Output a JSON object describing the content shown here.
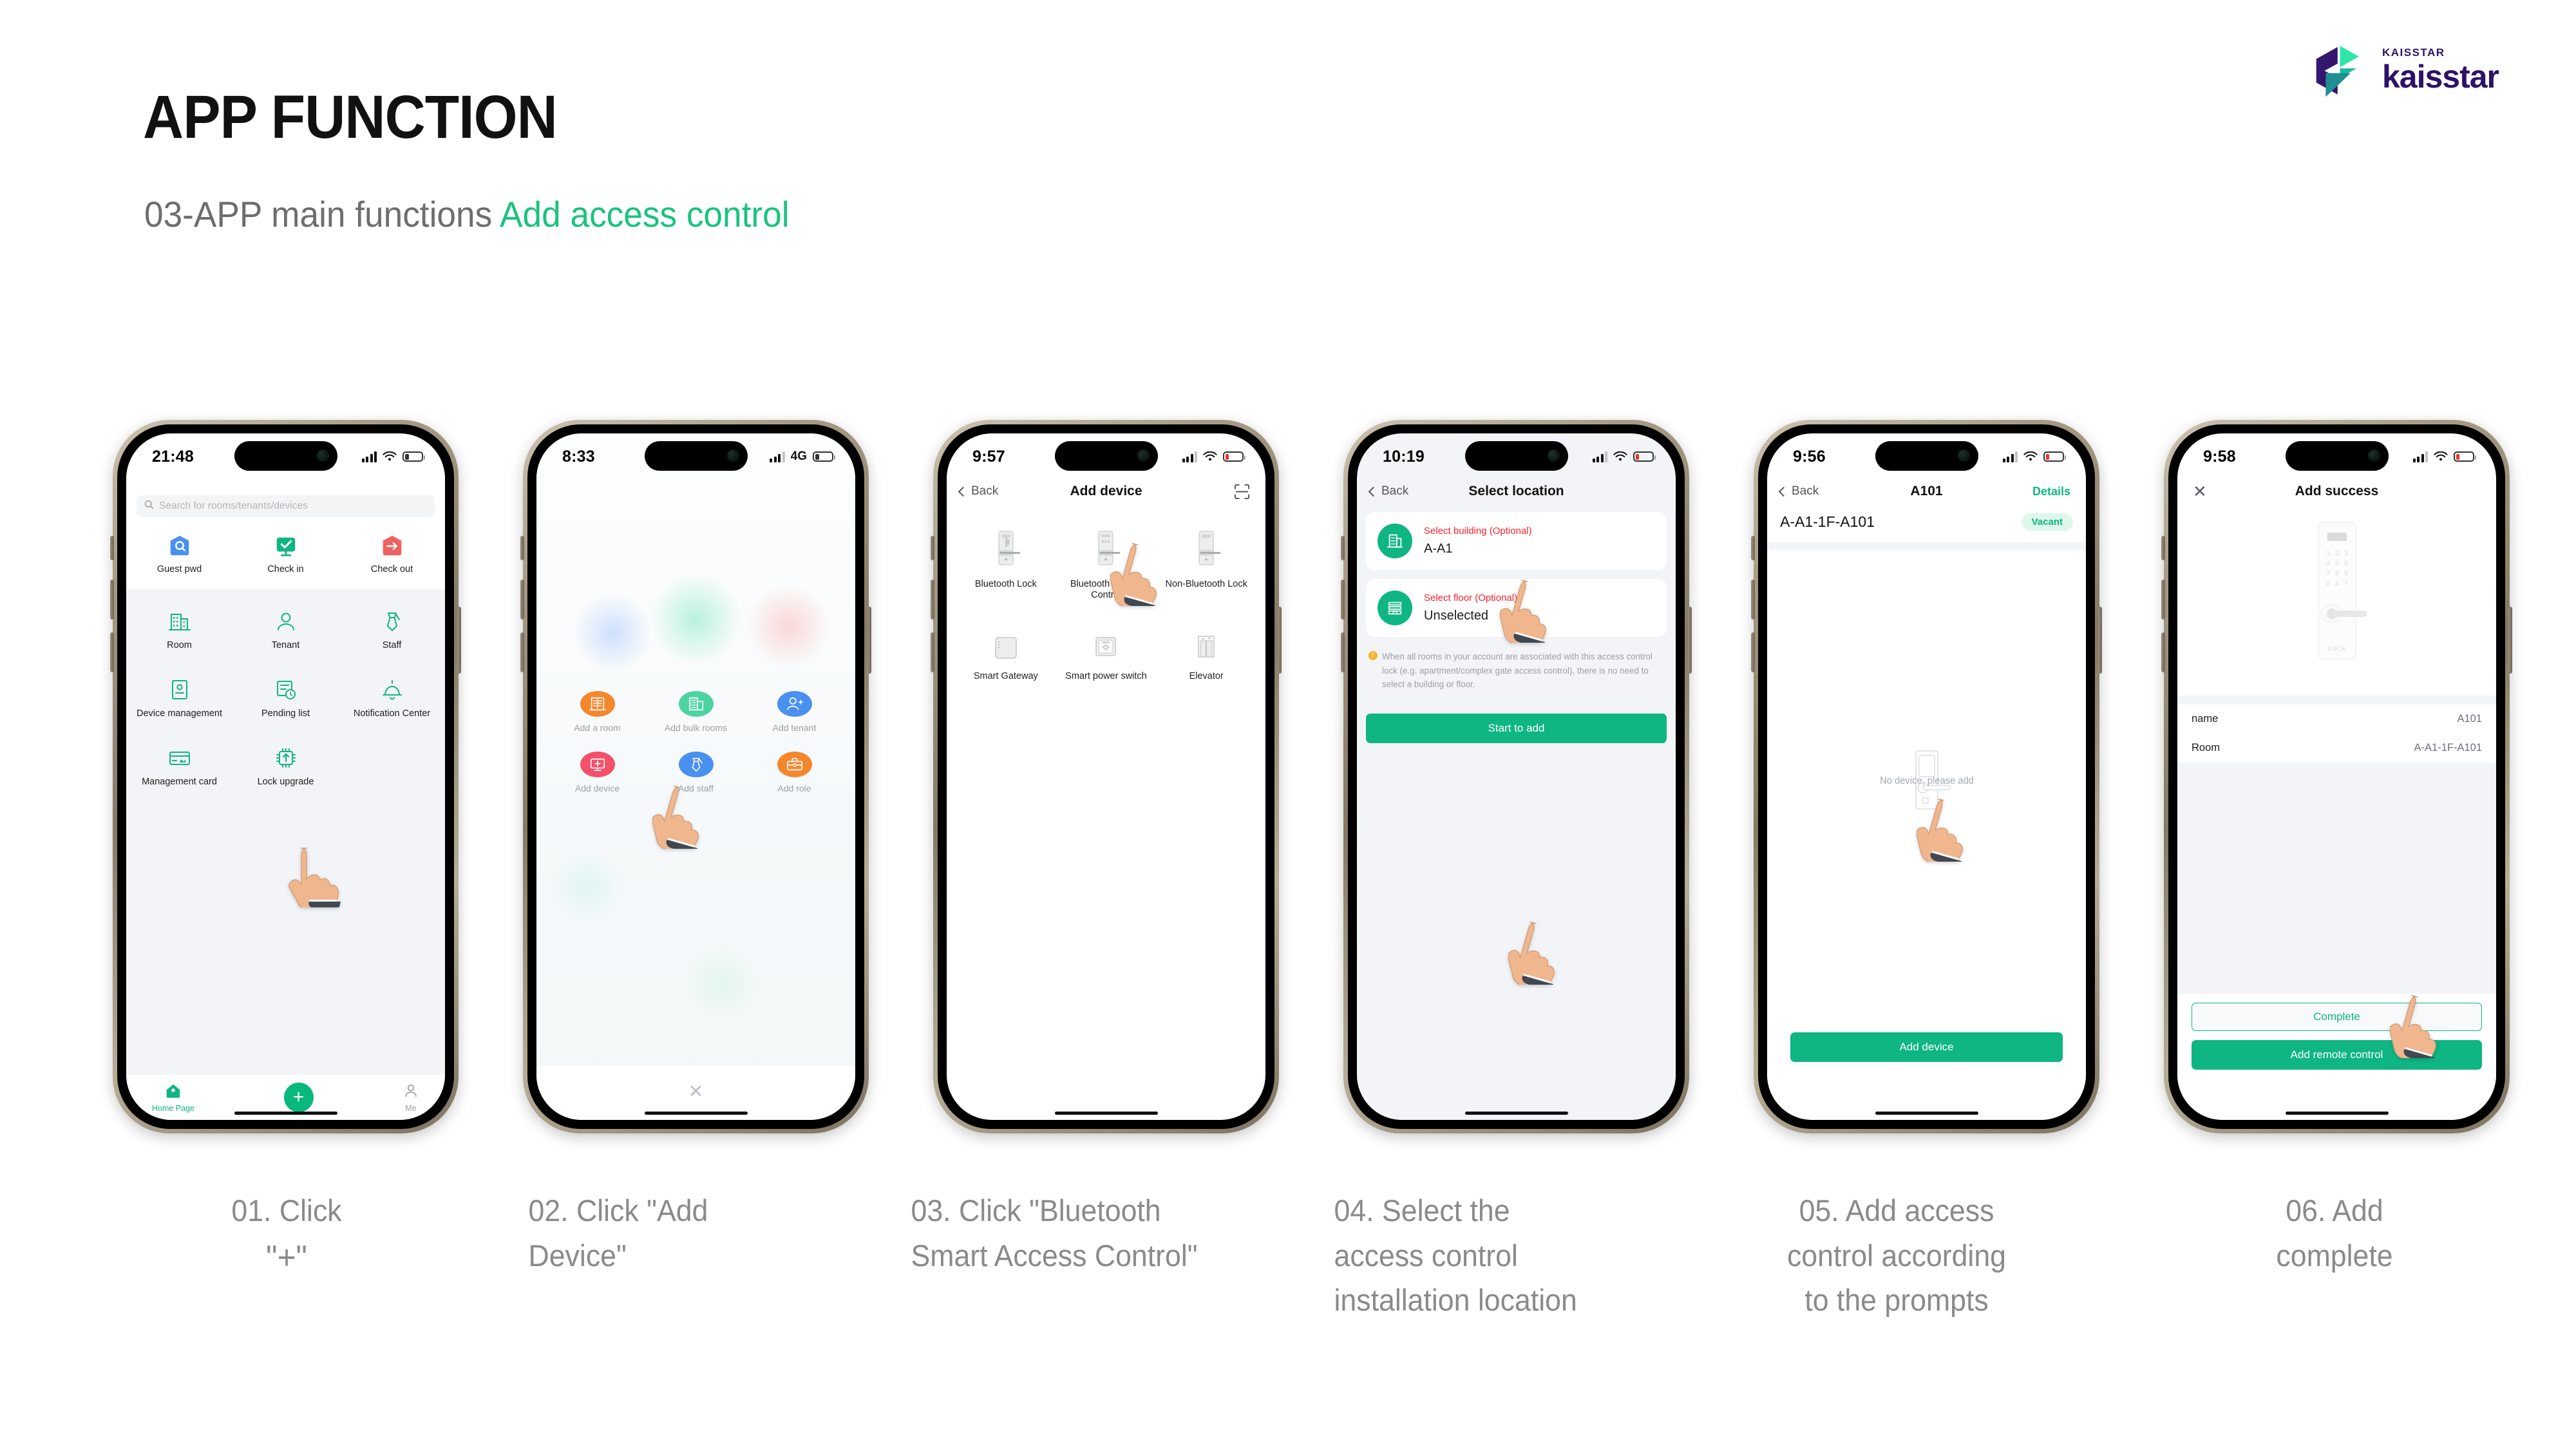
{
  "header": {
    "title": "APP FUNCTION",
    "subtitle_prefix": "03-APP main functions ",
    "subtitle_accent": "Add access control"
  },
  "brand": {
    "kicker": "KAISSTAR",
    "word": "kaisstar",
    "purple": "#2d1267",
    "teal": "#19c79b"
  },
  "theme": {
    "green": "#0fb583",
    "red": "#f5222d",
    "page_bg": "#ffffff",
    "screen_gray": "#f2f4f7"
  },
  "phones": [
    {
      "status": {
        "time": "21:48",
        "network": "",
        "battery_pct": 22,
        "battery_color": "#333333"
      },
      "search": {
        "placeholder": "Search for rooms/tenants/devices",
        "icon": "search-icon"
      },
      "quick_actions": [
        {
          "label": "Guest pwd",
          "icon": "shield-search-icon",
          "color": "#4a90f0"
        },
        {
          "label": "Check in",
          "icon": "monitor-check-icon",
          "color": "#0fb583"
        },
        {
          "label": "Check out",
          "icon": "shield-arrow-icon",
          "color": "#f16060"
        }
      ],
      "menu": [
        {
          "label": "Room",
          "icon": "building-icon"
        },
        {
          "label": "Tenant",
          "icon": "user-icon"
        },
        {
          "label": "Staff",
          "icon": "tie-icon"
        },
        {
          "label": "Device management",
          "icon": "device-card-icon"
        },
        {
          "label": "Pending list",
          "icon": "pending-clock-icon"
        },
        {
          "label": "Notification Center",
          "icon": "bell-icon"
        },
        {
          "label": "Management card",
          "icon": "card-icon"
        },
        {
          "label": "Lock upgrade",
          "icon": "chip-upgrade-icon"
        }
      ],
      "tabs": [
        {
          "label": "Home Page",
          "icon": "home-icon",
          "active": true
        },
        {
          "label": "",
          "icon": "plus-icon",
          "active": false
        },
        {
          "label": "Me",
          "icon": "person-icon",
          "active": false
        }
      ]
    },
    {
      "status": {
        "time": "8:33",
        "network": "4G",
        "battery_pct": 22,
        "battery_color": "#333333"
      },
      "actions": [
        {
          "label": "Add a room",
          "icon": "building-icon",
          "color": "#f4872c"
        },
        {
          "label": "Add bulk rooms",
          "icon": "buildings-icon",
          "color": "#4cd3a0"
        },
        {
          "label": "Add tenant",
          "icon": "user-plus-icon",
          "color": "#4a90f0"
        },
        {
          "label": "Add device",
          "icon": "monitor-plus-icon",
          "color": "#f4506a"
        },
        {
          "label": "Add staff",
          "icon": "tie-icon",
          "color": "#4a90f0"
        },
        {
          "label": "Add role",
          "icon": "briefcase-icon",
          "color": "#f4872c"
        }
      ],
      "close_icon": "close-icon"
    },
    {
      "status": {
        "time": "9:57",
        "network": "",
        "battery_pct": 16,
        "battery_color": "#f03030"
      },
      "nav": {
        "back": "Back",
        "title": "Add device",
        "right_icon": "scan-icon"
      },
      "devices": [
        {
          "label": "Bluetooth Lock",
          "icon": "bluetooth-lock-icon"
        },
        {
          "label": "Bluetooth Access Control",
          "icon": "access-control-icon"
        },
        {
          "label": "Non-Bluetooth Lock",
          "icon": "non-bluetooth-lock-icon"
        },
        {
          "label": "Smart Gateway",
          "icon": "gateway-icon"
        },
        {
          "label": "Smart power switch",
          "icon": "power-switch-icon"
        },
        {
          "label": "Elevator",
          "icon": "elevator-icon"
        }
      ]
    },
    {
      "status": {
        "time": "10:19",
        "network": "",
        "battery_pct": 16,
        "battery_color": "#f03030"
      },
      "nav": {
        "back": "Back",
        "title": "Select location"
      },
      "rows": [
        {
          "title": "Select building (Optional)",
          "value": "A-A1",
          "icon": "building-icon"
        },
        {
          "title": "Select floor (Optional)",
          "value": "Unselected",
          "icon": "floor-icon"
        }
      ],
      "note": "When all rooms in your account are associated with this access control lock (e.g. apartment/complex gate access control), there is no need to select a building or floor.",
      "note_icon": "warning-icon",
      "primary_button": "Start to add"
    },
    {
      "status": {
        "time": "9:56",
        "network": "",
        "battery_pct": 16,
        "battery_color": "#f03030"
      },
      "nav": {
        "back": "Back",
        "title": "A101",
        "right": "Details"
      },
      "room_path": "A-A1-1F-A101",
      "badge": "Vacant",
      "empty_text": "No device, please add",
      "empty_icon": "door-lock-icon",
      "primary_button": "Add device"
    },
    {
      "status": {
        "time": "9:58",
        "network": "",
        "battery_pct": 16,
        "battery_color": "#f03030"
      },
      "nav": {
        "close_icon": "close-icon",
        "title": "Add success"
      },
      "hero_icon": "smart-lock-image",
      "hero_keys": [
        "1",
        "2",
        "3",
        "4",
        "5",
        "6",
        "7",
        "8",
        "9",
        "0",
        "#",
        "*"
      ],
      "hero_brand": "LOCK",
      "rows": [
        {
          "key": "name",
          "value": "A101"
        },
        {
          "key": "Room",
          "value": "A-A1-1F-A101"
        }
      ],
      "secondary_button": "Complete",
      "primary_button": "Add remote control"
    }
  ],
  "captions": [
    {
      "line1": "01. Click",
      "line2": "\"+\"",
      "line3": ""
    },
    {
      "line1": "02. Click \"Add",
      "line2": "Device\"",
      "line3": ""
    },
    {
      "line1": "03. Click \"Bluetooth",
      "line2": "Smart Access Control\"",
      "line3": ""
    },
    {
      "line1": "04. Select the",
      "line2": "access control",
      "line3": "installation location"
    },
    {
      "line1": "05. Add access",
      "line2": "control according",
      "line3": "to the prompts"
    },
    {
      "line1": "06. Add",
      "line2": "complete",
      "line3": ""
    }
  ]
}
